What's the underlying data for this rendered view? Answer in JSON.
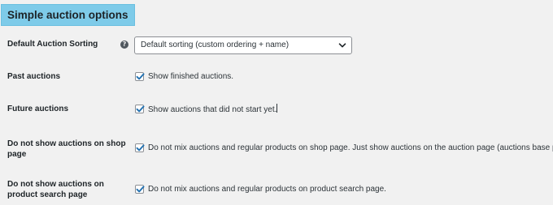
{
  "section": {
    "title": "Simple auction options"
  },
  "sorting": {
    "label": "Default Auction Sorting",
    "help_icon": "?",
    "selected": "Default sorting (custom ordering + name)"
  },
  "past": {
    "label": "Past auctions",
    "checked": true,
    "text": "Show finished auctions."
  },
  "future": {
    "label": "Future auctions",
    "checked": true,
    "text": "Show auctions that did not start yet."
  },
  "shop": {
    "label_line1": "Do not show auctions on shop",
    "label_line2": "page",
    "checked": true,
    "text": "Do not mix auctions and regular products on shop page. Just show auctions on the auction page (auctions base page)"
  },
  "search": {
    "label_line1": "Do not show auctions on",
    "label_line2": "product search page",
    "checked": true,
    "text": "Do not mix auctions and regular products on product search page."
  },
  "colors": {
    "accent": "#2271b1",
    "header_bg": "#7ecbe9",
    "page_bg": "#f1f1f1"
  },
  "icons": {
    "help": "help-icon",
    "select_arrow": "chevron-down-icon",
    "check": "checkmark-icon"
  }
}
